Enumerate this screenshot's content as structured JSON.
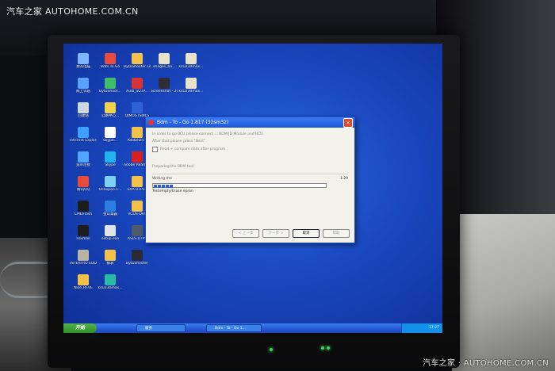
{
  "watermark": {
    "top": "汽车之家  AUTOHOME.COM.CN",
    "bottom": "汽车之家 · AUTOHOME.COM.CN"
  },
  "desktop_icons": [
    {
      "label": "我的电脑",
      "color": "#7fb5ff"
    },
    {
      "label": "Bdm To Go",
      "color": "#e84a3b"
    },
    {
      "label": "BytuShooter Log",
      "color": "#f2c14a"
    },
    {
      "label": "images_ba...",
      "color": "#e8e3c9"
    },
    {
      "label": "ksU230max...",
      "color": "#e8e3c9"
    },
    {
      "label": "网上邻居",
      "color": "#59a3ff"
    },
    {
      "label": "BytuShoot...",
      "color": "#3fbd6a"
    },
    {
      "label": "Audi_SOTP...",
      "color": "#d9333a"
    },
    {
      "label": "Screenshot - 2010_07_2...",
      "color": "#2e2e3a"
    },
    {
      "label": "ksU230max...",
      "color": "#e8e3c9"
    },
    {
      "label": "回收站",
      "color": "#cfd6de"
    },
    {
      "label": "公路中心...",
      "color": "#f0d34c"
    },
    {
      "label": "DIMOSTSWLS",
      "color": "#2e63d6"
    },
    {
      "label": "Internet Explorer",
      "color": "#3fa0ff"
    },
    {
      "label": "Skype...",
      "color": "#ffffff"
    },
    {
      "label": "AdobeDd...",
      "color": "#f2c14a"
    },
    {
      "label": "宽带连接",
      "color": "#50a6ff"
    },
    {
      "label": "Skype",
      "color": "#1fb3f0"
    },
    {
      "label": "Adobe Reader XI",
      "color": "#d82121"
    },
    {
      "label": "腾讯QQ",
      "color": "#e84a3b"
    },
    {
      "label": "Ocoupon.1...",
      "color": "#7ecff6"
    },
    {
      "label": "SXA UTPS1",
      "color": "#f2c14a"
    },
    {
      "label": "CMDFlash",
      "color": "#1d1d1d"
    },
    {
      "label": "金山毒霸",
      "color": "#2c7ee0"
    },
    {
      "label": "VCDS-DRV",
      "color": "#f2c14a"
    },
    {
      "label": "Foxmail",
      "color": "#1d1d1d"
    },
    {
      "label": "setup.exe",
      "color": "#dfe4ea"
    },
    {
      "label": "ASLS UTPS",
      "color": "#4f5a6a"
    },
    {
      "label": "INTERFRO EDOORW...",
      "color": "#b9b3a4"
    },
    {
      "label": "报表",
      "color": "#f2c14a"
    },
    {
      "label": "BytuShooter",
      "color": "#2a2a3a"
    },
    {
      "label": "Nise_RFVE",
      "color": "#f2c14a"
    },
    {
      "label": "ksU230max...",
      "color": "#2bb8a9"
    }
  ],
  "dialog": {
    "title": "Bdm - To - Go  1.817 (32sm32)",
    "close_label": "×",
    "line1": "In order to go BCU please connect ... BDM/JD Module and BCU",
    "line2": "After that please press \"Next\"",
    "checkbox_label": "Read + compare data after program",
    "line3": "Preparing the BDM tool",
    "status_label": "Writing the",
    "status_value": "1:29",
    "progress_fraction": 0.12,
    "progress_caption": "Testempty/Erase epron",
    "buttons": {
      "back": "< 上一步",
      "next": "下一步 >",
      "cancel": "取消",
      "help": "帮助"
    }
  },
  "taskbar": {
    "start_label": "开始",
    "items": [
      "服务",
      "Bdm - To - Go  1..."
    ],
    "clock": "17:27"
  }
}
